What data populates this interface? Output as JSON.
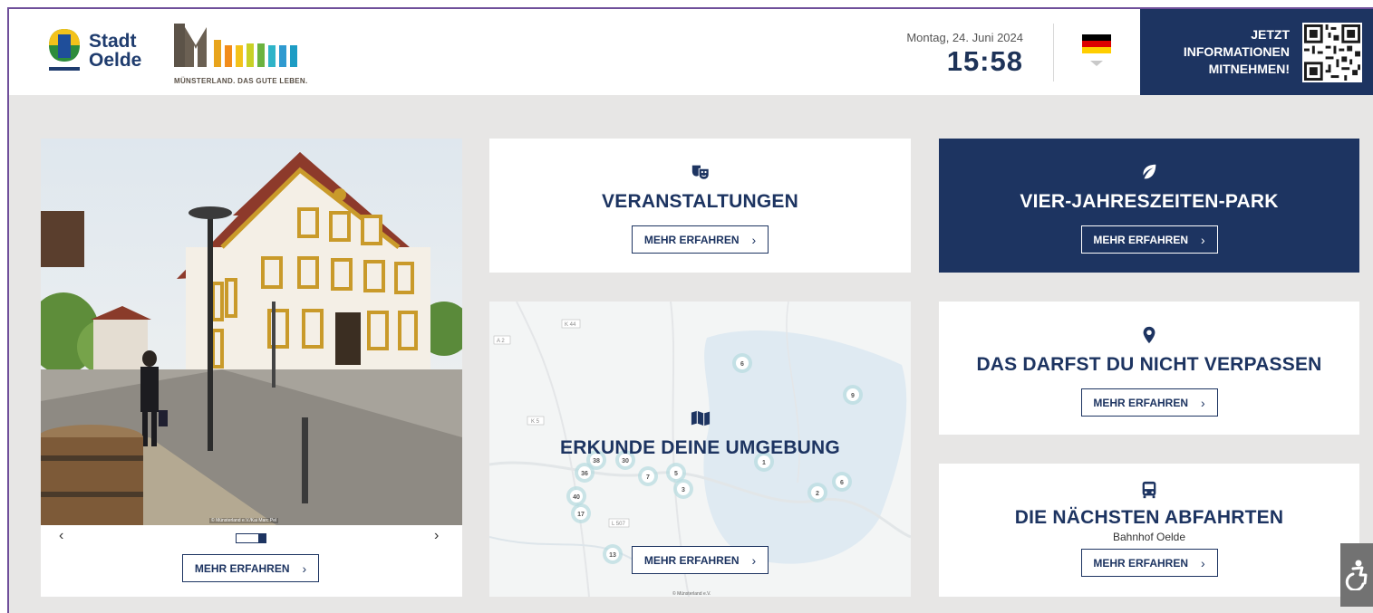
{
  "header": {
    "city_logo": {
      "line1": "Stadt",
      "line2": "Oelde"
    },
    "region_logo": {
      "caption": "MÜNSTERLAND. DAS GUTE LEBEN."
    },
    "date": "Montag, 24. Juni 2024",
    "time": "15:58",
    "language": {
      "flag_icon": "germany-flag-icon",
      "colors": [
        "#000000",
        "#dd0000",
        "#ffce00"
      ]
    },
    "info_box": {
      "text": "JETZT INFORMATIONEN MITNEHMEN!",
      "qr_icon": "qr-code-icon"
    }
  },
  "hero": {
    "credit": "© Münsterland e.V./Kai Marc Pel",
    "prev": "‹",
    "next": "›",
    "button_label": "MEHR ERFAHREN",
    "slide_position": {
      "current": 2,
      "total": 2
    }
  },
  "cards": {
    "events": {
      "icon": "theater-masks-icon",
      "title": "VERANSTALTUNGEN",
      "button_label": "MEHR ERFAHREN"
    },
    "park": {
      "icon": "leaf-icon",
      "title": "VIER-JAHRESZEITEN-PARK",
      "button_label": "MEHR ERFAHREN"
    },
    "explore": {
      "icon": "map-icon",
      "title": "ERKUNDE DEINE UMGEBUNG",
      "button_label": "MEHR ERFAHREN",
      "credit": "© Münsterland e.V.",
      "road_labels": [
        "K 44",
        "A 2",
        "K 5",
        "L 507"
      ],
      "marker_counts": [
        "6",
        "9",
        "38",
        "36",
        "30",
        "7",
        "5",
        "3",
        "1",
        "40",
        "17",
        "2",
        "6",
        "13"
      ]
    },
    "dont_miss": {
      "icon": "map-marker-icon",
      "title": "DAS DARFST DU NICHT VERPASSEN",
      "button_label": "MEHR ERFAHREN"
    },
    "departures": {
      "icon": "bus-icon",
      "title": "DIE NÄCHSTEN ABFAHRTEN",
      "subtitle": "Bahnhof Oelde",
      "button_label": "MEHR ERFAHREN"
    }
  },
  "accessibility": {
    "icon": "accessibility-icon"
  },
  "colors": {
    "navy": "#1d3461",
    "background": "#e7e6e5",
    "frame": "#6f4f9a"
  }
}
